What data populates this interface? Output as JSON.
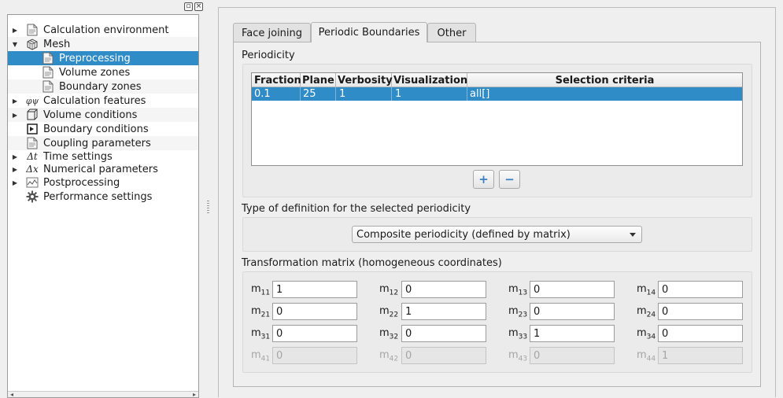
{
  "tree": {
    "items": [
      {
        "label": "Calculation environment",
        "icon": "document-icon"
      },
      {
        "label": "Mesh",
        "icon": "mesh-cube-icon"
      },
      {
        "label": "Preprocessing",
        "icon": "document-icon"
      },
      {
        "label": "Volume zones",
        "icon": "document-icon"
      },
      {
        "label": "Boundary zones",
        "icon": "document-icon"
      },
      {
        "label": "Calculation features",
        "icon": "phi-symbol-icon"
      },
      {
        "label": "Volume conditions",
        "icon": "cube-icon"
      },
      {
        "label": "Boundary conditions",
        "icon": "boundary-icon"
      },
      {
        "label": "Coupling parameters",
        "icon": "document-icon"
      },
      {
        "label": "Time settings",
        "icon": "delta-t-icon"
      },
      {
        "label": "Numerical parameters",
        "icon": "delta-x-icon"
      },
      {
        "label": "Postprocessing",
        "icon": "chart-icon"
      },
      {
        "label": "Performance settings",
        "icon": "gear-icon"
      }
    ],
    "delta_t": "Δt",
    "delta_x": "Δx",
    "phi": "φψ",
    "selected_color": "#308cc6"
  },
  "tabs": [
    "Face joining",
    "Periodic Boundaries",
    "Other"
  ],
  "periodicity": {
    "title": "Periodicity",
    "columns": [
      "Fraction",
      "Plane",
      "Verbosity",
      "Visualization",
      "Selection criteria"
    ],
    "rows": [
      [
        "0.1",
        "25",
        "1",
        "1",
        "all[]"
      ]
    ],
    "add_label": "+",
    "remove_label": "−"
  },
  "definition": {
    "title": "Type of definition for the selected periodicity",
    "selected": "Composite periodicity (defined by matrix)"
  },
  "matrix": {
    "title": "Transformation matrix (homogeneous coordinates)",
    "label_prefix": "m",
    "cells": [
      [
        {
          "sub": "11",
          "value": "1"
        },
        {
          "sub": "12",
          "value": "0"
        },
        {
          "sub": "13",
          "value": "0"
        },
        {
          "sub": "14",
          "value": "0"
        }
      ],
      [
        {
          "sub": "21",
          "value": "0"
        },
        {
          "sub": "22",
          "value": "1"
        },
        {
          "sub": "23",
          "value": "0"
        },
        {
          "sub": "24",
          "value": "0"
        }
      ],
      [
        {
          "sub": "31",
          "value": "0"
        },
        {
          "sub": "32",
          "value": "0"
        },
        {
          "sub": "33",
          "value": "1"
        },
        {
          "sub": "34",
          "value": "0"
        }
      ],
      [
        {
          "sub": "41",
          "value": "0"
        },
        {
          "sub": "42",
          "value": "0"
        },
        {
          "sub": "43",
          "value": "0"
        },
        {
          "sub": "44",
          "value": "1"
        }
      ]
    ]
  }
}
